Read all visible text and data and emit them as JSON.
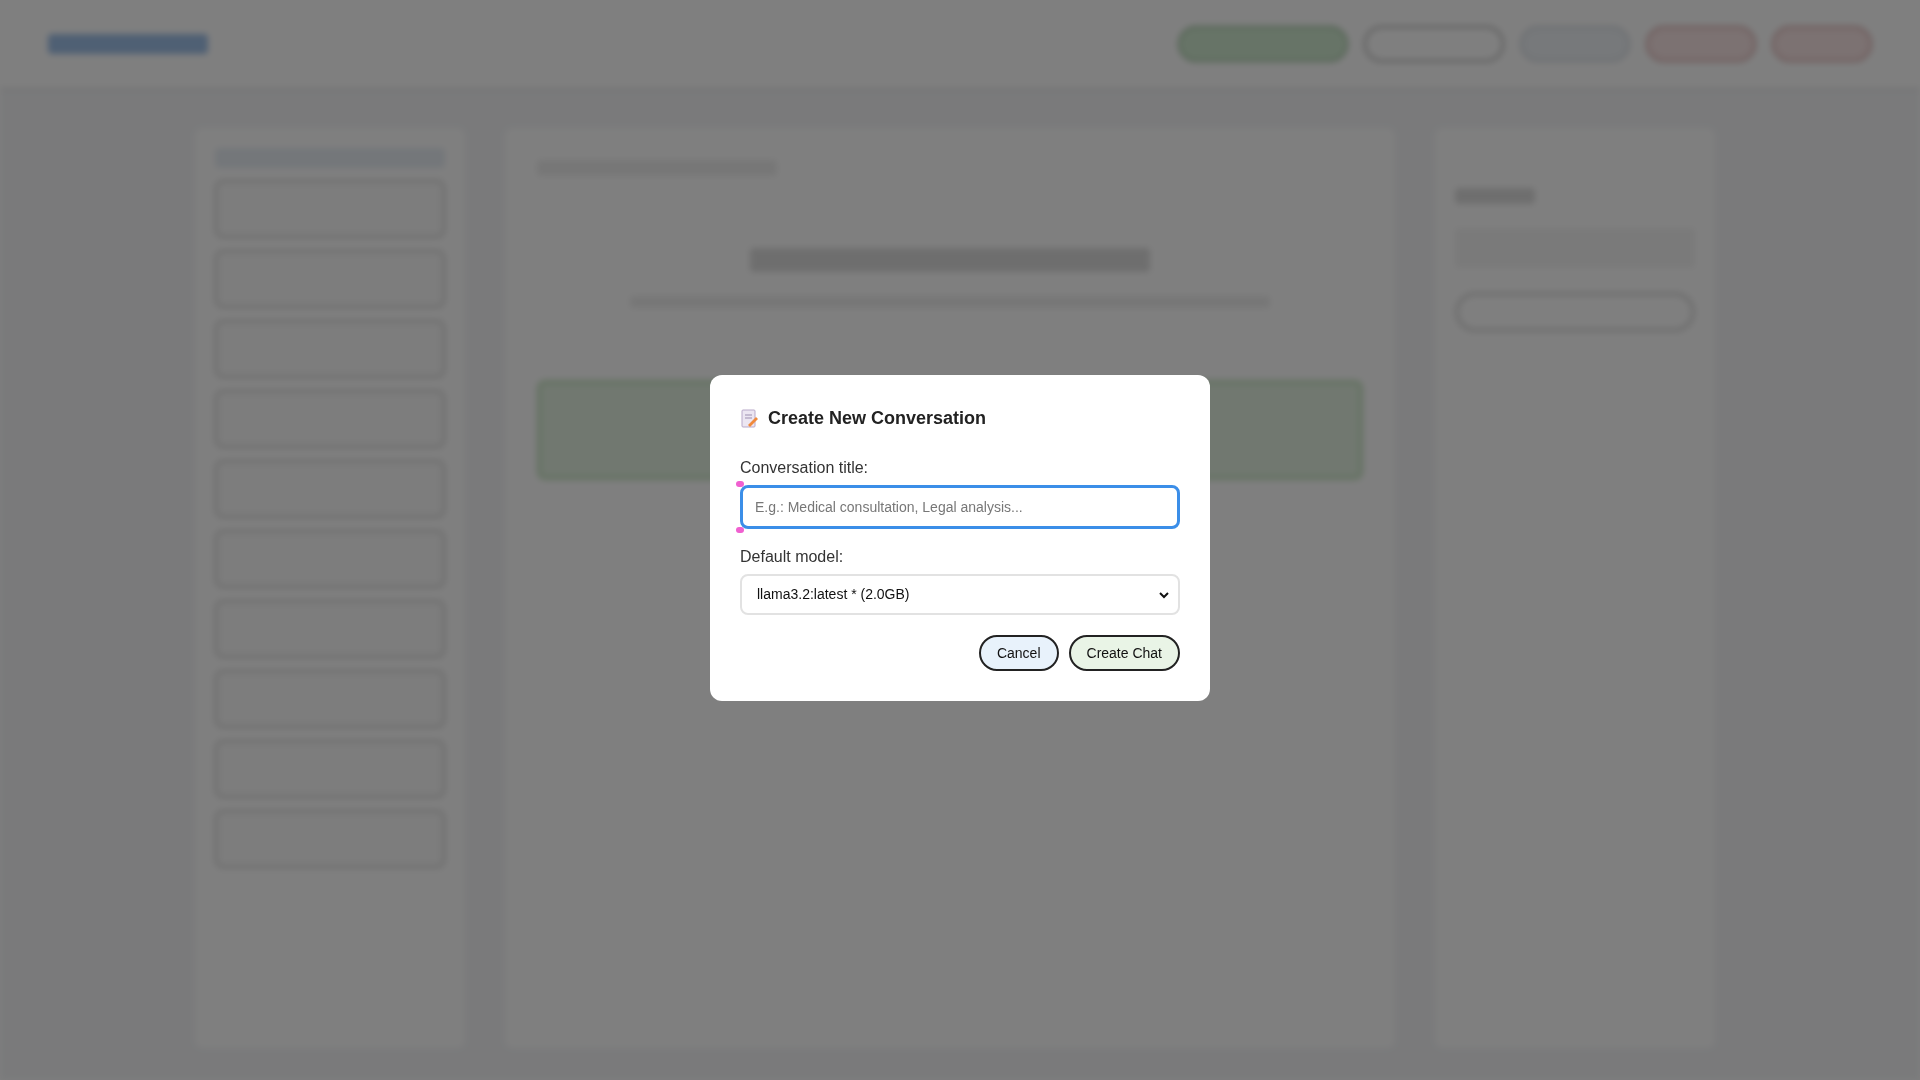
{
  "dialog": {
    "title": "Create New Conversation",
    "fields": [
      {
        "kind": "text",
        "label": "Conversation title:",
        "placeholder": "E.g.: Medical consultation, Legal analysis...",
        "focused": true
      },
      {
        "kind": "select",
        "label": "Default model:",
        "value": "llama3.2:latest * (2.0GB)",
        "focused": false
      }
    ],
    "buttons": [
      {
        "label": "Cancel",
        "kind": "secondary"
      },
      {
        "label": "Create Chat",
        "kind": "primary"
      }
    ]
  }
}
